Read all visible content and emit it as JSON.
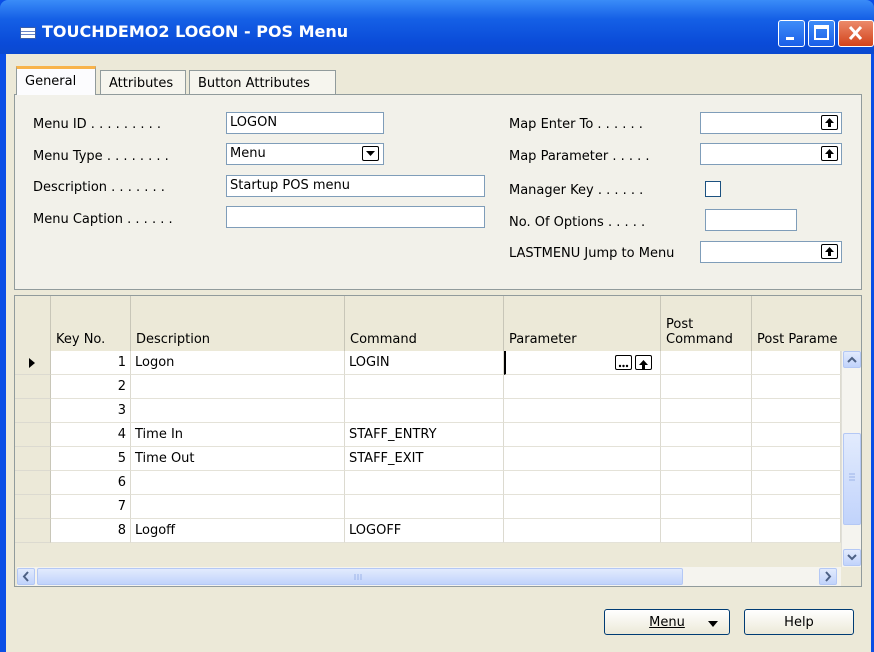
{
  "window": {
    "title": "TOUCHDEMO2 LOGON - POS Menu",
    "title_icon": "form-icon",
    "controls": [
      "minimize-icon",
      "maximize-icon",
      "close-icon"
    ]
  },
  "tabs": [
    {
      "label": "General",
      "active": true
    },
    {
      "label": "Attributes",
      "active": false
    },
    {
      "label": "Button Attributes",
      "active": false
    }
  ],
  "general": {
    "menu_id": {
      "label": "Menu ID . . . . . . . . .",
      "value": "LOGON"
    },
    "menu_type": {
      "label": "Menu Type . . . . . . . .",
      "value": "Menu"
    },
    "description": {
      "label": "Description . . . . . . .",
      "value": "Startup POS menu"
    },
    "menu_caption": {
      "label": "Menu Caption . . . . . .",
      "value": ""
    },
    "map_enter_to": {
      "label": "Map Enter To . . . . . .",
      "value": ""
    },
    "map_parameter": {
      "label": "Map Parameter . . . . .",
      "value": ""
    },
    "manager_key": {
      "label": "Manager Key . . . . . .",
      "checked": false
    },
    "no_of_options": {
      "label": "No. Of Options . . . . .",
      "value": ""
    },
    "lastmenu_jump": {
      "label": "LASTMENU Jump to Menu",
      "value": ""
    }
  },
  "grid": {
    "columns": [
      "Key No.",
      "Description",
      "Command",
      "Parameter",
      "Post\nCommand",
      "Post Parame"
    ],
    "rows": [
      {
        "key": "1",
        "description": "Logon",
        "command": "LOGIN",
        "parameter": "",
        "post_command": "",
        "post_parameter": "",
        "selected": true
      },
      {
        "key": "2",
        "description": "",
        "command": "",
        "parameter": "",
        "post_command": "",
        "post_parameter": ""
      },
      {
        "key": "3",
        "description": "",
        "command": "",
        "parameter": "",
        "post_command": "",
        "post_parameter": ""
      },
      {
        "key": "4",
        "description": "Time In",
        "command": "STAFF_ENTRY",
        "parameter": "",
        "post_command": "",
        "post_parameter": ""
      },
      {
        "key": "5",
        "description": "Time Out",
        "command": "STAFF_EXIT",
        "parameter": "",
        "post_command": "",
        "post_parameter": ""
      },
      {
        "key": "6",
        "description": "",
        "command": "",
        "parameter": "",
        "post_command": "",
        "post_parameter": ""
      },
      {
        "key": "7",
        "description": "",
        "command": "",
        "parameter": "",
        "post_command": "",
        "post_parameter": ""
      },
      {
        "key": "8",
        "description": "Logoff",
        "command": "LOGOFF",
        "parameter": "",
        "post_command": "",
        "post_parameter": ""
      }
    ]
  },
  "buttons": {
    "menu": "Menu",
    "help": "Help"
  },
  "colors": {
    "titlebar": "#0a4bd8",
    "close_button": "#d3431b",
    "tab_highlight": "#f8b34a",
    "panel_bg": "#ece9d8"
  }
}
